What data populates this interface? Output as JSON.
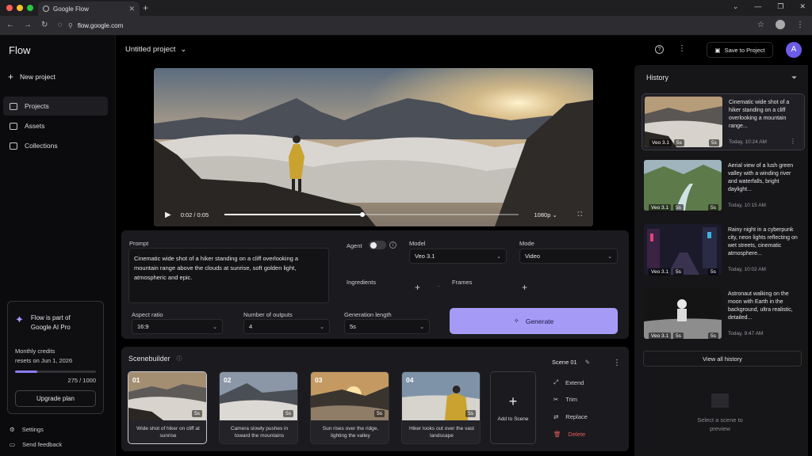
{
  "browser": {
    "tab_title": "Google Flow",
    "url": "flow.google.com",
    "dot_colors": [
      "#ff5f57",
      "#febc2e",
      "#28c840"
    ]
  },
  "sidebar": {
    "logo": "Flow",
    "new_project": "New project",
    "nav": [
      {
        "label": "Projects",
        "icon": "folder-icon",
        "active": true
      },
      {
        "label": "Assets",
        "icon": "image-icon",
        "active": false
      },
      {
        "label": "Collections",
        "icon": "collection-icon",
        "active": false
      }
    ],
    "promo": {
      "line1": "Flow is part of",
      "line2": "Google AI Pro",
      "credits_line1": "Monthly credits",
      "credits_line2": "resets on Jun 1, 2026",
      "credits_used_fraction": 0.275,
      "credits_count": "275 / 1000",
      "upgrade": "Upgrade plan"
    },
    "settings": "Settings",
    "feedback": "Send feedback"
  },
  "header": {
    "project_title": "Untitled project",
    "save_button": "Save to Project",
    "avatar_initial": "A"
  },
  "video": {
    "time": "0:02 / 0:05",
    "progress_fraction": 0.47,
    "quality": "1080p"
  },
  "prompt_panel": {
    "prompt_label": "Prompt",
    "prompt_text": "Cinematic wide shot of a hiker standing on a cliff overlooking a mountain range above the clouds at sunrise, soft golden light, atmospheric and epic.",
    "agent_label": "Agent",
    "model_label": "Model",
    "model_value": "Veo 3.1",
    "mode_label": "Mode",
    "mode_value": "Video",
    "ingredients_label": "Ingredients",
    "frames_label": "Frames",
    "aspect_label": "Aspect ratio",
    "aspect_value": "16:9",
    "outputs_label": "Number of outputs",
    "outputs_value": "4",
    "length_label": "Generation length",
    "length_value": "5s",
    "generate": "Generate"
  },
  "scenebuilder": {
    "title": "Scenebuilder",
    "scenes": [
      {
        "num": "01",
        "duration": "5s",
        "caption": "Wide shot of hiker on cliff at sunrise"
      },
      {
        "num": "02",
        "duration": "5s",
        "caption": "Camera slowly pushes in toward the mountains"
      },
      {
        "num": "03",
        "duration": "5s",
        "caption": "Sun rises over the ridge, lighting the valley"
      },
      {
        "num": "04",
        "duration": "5s",
        "caption": "Hiker looks out over the vast landscape"
      }
    ],
    "add_scene": "Add to Scene",
    "scene_name": "Scene 01",
    "actions": [
      "Extend",
      "Trim",
      "Replace",
      "Delete"
    ]
  },
  "history": {
    "title": "History",
    "items": [
      {
        "model": "Veo 3.1",
        "badge2": "5s",
        "duration": "5s",
        "desc": "Cinematic wide shot of a hiker standing on a cliff overlooking a mountain range...",
        "time": "Today, 10:24 AM"
      },
      {
        "model": "Veo 3.1",
        "badge2": "5s",
        "duration": "5s",
        "desc": "Aerial view of a lush green valley with a winding river and waterfalls, bright daylight...",
        "time": "Today, 10:15 AM"
      },
      {
        "model": "Veo 3.1",
        "badge2": "5s",
        "duration": "5s",
        "desc": "Rainy night in a cyberpunk city, neon lights reflecting on wet streets, cinematic atmosphere...",
        "time": "Today, 10:02 AM"
      },
      {
        "model": "Veo 3.1",
        "badge2": "5s",
        "duration": "5s",
        "desc": "Astronaut walking on the moon with Earth in the background, ultra realistic, detailed...",
        "time": "Today, 9:47 AM"
      }
    ],
    "view_all": "View all history",
    "preview_line1": "Select a scene to",
    "preview_line2": "preview"
  }
}
